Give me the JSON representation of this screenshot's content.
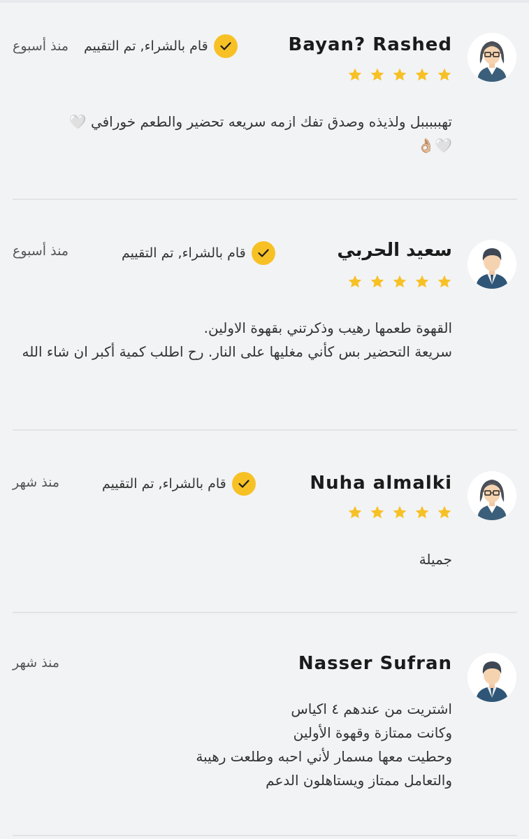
{
  "reviews": [
    {
      "name": "Bayan? Rashed",
      "verified_label": "قام بالشراء, تم التقييم",
      "time": "منذ أسبوع",
      "rating": 5,
      "avatar": "female-avatar-icon",
      "text": "تهبببببل ولذيذه وصدق تفك ازمه سريعه تحضير والطعم خورافي 🤍\n🤍👌🏼"
    },
    {
      "name": "سعيد الحربي",
      "verified_label": "قام بالشراء, تم التقييم",
      "time": "منذ أسبوع",
      "rating": 5,
      "avatar": "male-avatar-icon",
      "text": "القهوة طعمها رهيب وذكرتني بقهوة الاولين.\nسريعة التحضير بس كأني مغليها على النار. رح اطلب كمية أكبر ان شاء الله"
    },
    {
      "name": "Nuha almalki",
      "verified_label": "قام بالشراء, تم التقييم",
      "time": "منذ شهر",
      "rating": 5,
      "avatar": "female-avatar-icon",
      "text": "جميلة"
    },
    {
      "name": "Nasser Sufran",
      "time": "منذ شهر",
      "avatar": "male-avatar-icon",
      "text": "اشتريت من عندهم ٤ اكياس\nوكانت ممتازة وقهوة الأولين\nوحطيت معها مسمار لأني احبه وطلعت رهيبة\nوالتعامل ممتاز ويستاهلون الدعم"
    }
  ],
  "colors": {
    "background": "#f2f3f5",
    "accent": "#f7c126",
    "divider": "#e2e3e6"
  }
}
